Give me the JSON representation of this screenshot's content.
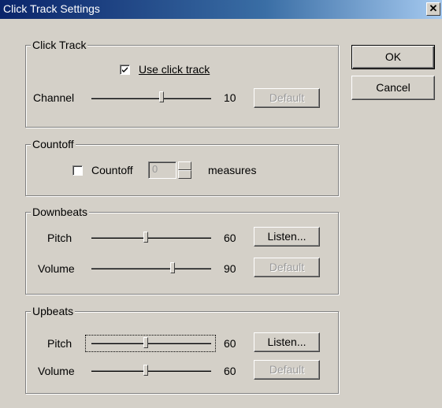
{
  "window": {
    "title": "Click Track Settings",
    "close_glyph": "✕"
  },
  "click_track": {
    "legend": "Click Track",
    "use_click_track_label": "Use click track",
    "use_click_track_checked": true,
    "channel_label": "Channel",
    "channel_value": "10",
    "channel_slider_fraction": 0.6,
    "default_label": "Default"
  },
  "countoff": {
    "legend": "Countoff",
    "countoff_label": "Countoff",
    "countoff_checked": false,
    "measures_value": "0",
    "measures_label": "measures"
  },
  "downbeats": {
    "legend": "Downbeats",
    "pitch_label": "Pitch",
    "pitch_value": "60",
    "pitch_slider_fraction": 0.47,
    "volume_label": "Volume",
    "volume_value": "90",
    "volume_slider_fraction": 0.7,
    "listen_label": "Listen...",
    "default_label": "Default"
  },
  "upbeats": {
    "legend": "Upbeats",
    "pitch_label": "Pitch",
    "pitch_value": "60",
    "pitch_slider_fraction": 0.47,
    "volume_label": "Volume",
    "volume_value": "60",
    "volume_slider_fraction": 0.47,
    "listen_label": "Listen...",
    "default_label": "Default"
  },
  "buttons": {
    "ok_label": "OK",
    "cancel_label": "Cancel"
  }
}
